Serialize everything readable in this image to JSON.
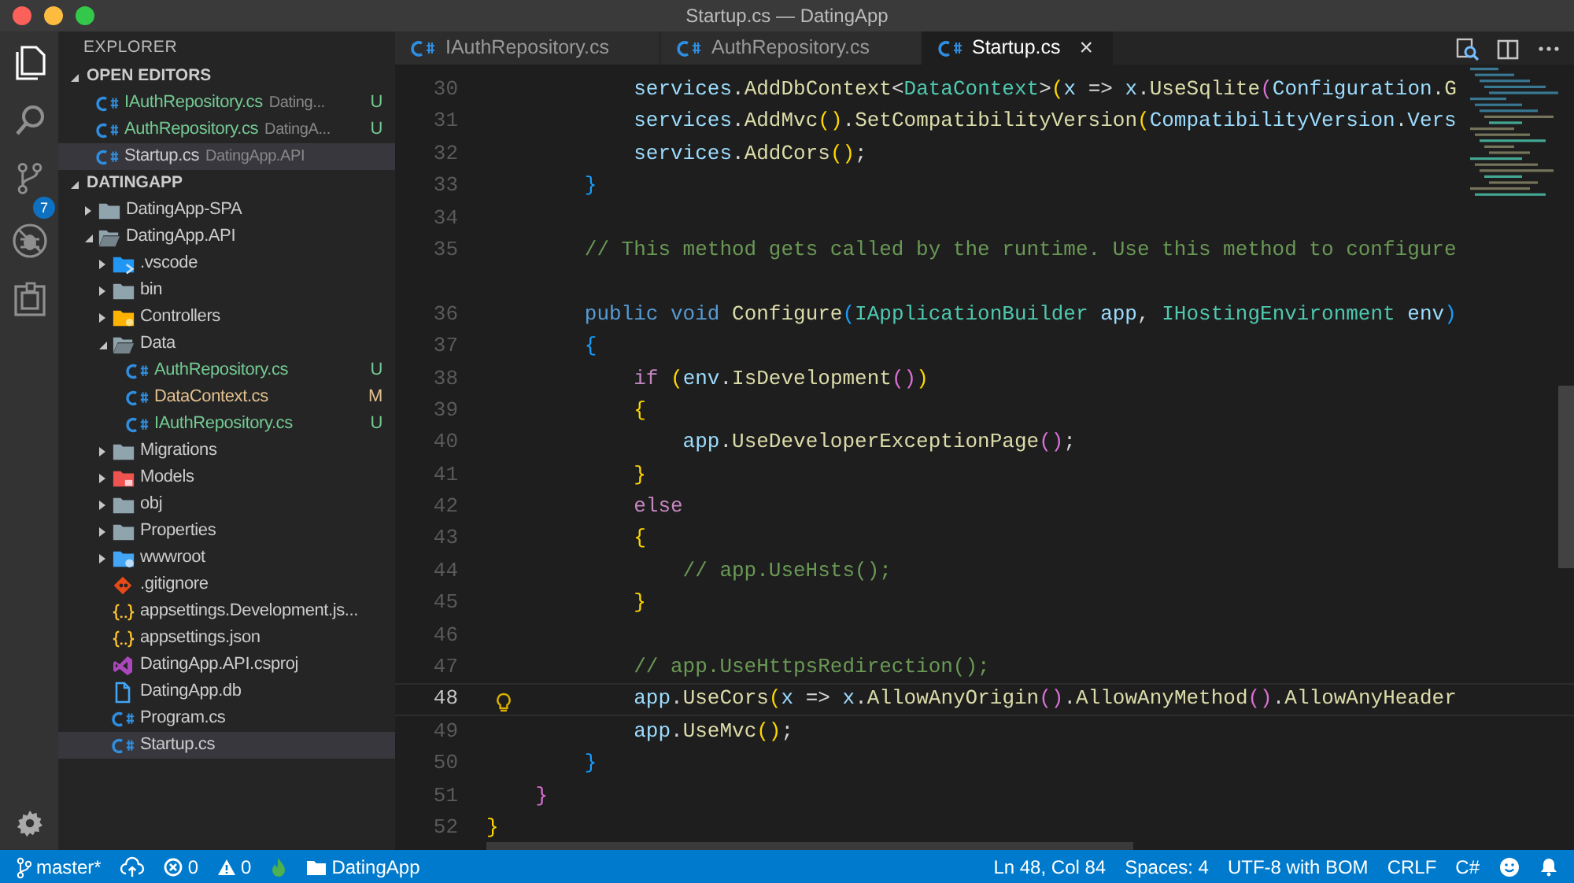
{
  "window": {
    "title": "Startup.cs — DatingApp"
  },
  "activity_bar": {
    "items": [
      {
        "kind": "files",
        "selected": true
      },
      {
        "kind": "search",
        "selected": false
      },
      {
        "kind": "source-control",
        "selected": false,
        "badge": "7"
      },
      {
        "kind": "debug",
        "selected": false
      },
      {
        "kind": "extensions",
        "selected": false
      }
    ]
  },
  "sidebar": {
    "title": "EXPLORER",
    "open_editors": {
      "title": "OPEN EDITORS",
      "expanded": true,
      "items": [
        {
          "kind": "csharp",
          "name": "IAuthRepository.cs",
          "description": "Dating...",
          "git": "U",
          "selected": false
        },
        {
          "kind": "csharp",
          "name": "AuthRepository.cs",
          "description": "DatingA...",
          "git": "U",
          "selected": false
        },
        {
          "kind": "csharp",
          "name": "Startup.cs",
          "description": "DatingApp.API",
          "selected": true
        }
      ]
    },
    "workspace": {
      "title": "DATINGAPP",
      "expanded": true,
      "tree": [
        {
          "kind": "folder",
          "name": "DatingApp-SPA",
          "expanded": false,
          "selected": false
        },
        {
          "kind": "folder",
          "name": "DatingApp.API",
          "expanded": true,
          "selected": false,
          "children": [
            {
              "kind": "folder-vscode",
              "name": ".vscode",
              "expanded": false,
              "selected": false
            },
            {
              "kind": "folder",
              "name": "bin",
              "expanded": false,
              "selected": false
            },
            {
              "kind": "folder-controllers",
              "name": "Controllers",
              "expanded": false,
              "selected": false
            },
            {
              "kind": "folder",
              "name": "Data",
              "expanded": true,
              "selected": false,
              "children": [
                {
                  "kind": "csharp",
                  "name": "AuthRepository.cs",
                  "git": "U",
                  "selected": false
                },
                {
                  "kind": "csharp",
                  "name": "DataContext.cs",
                  "git": "M",
                  "selected": false
                },
                {
                  "kind": "csharp",
                  "name": "IAuthRepository.cs",
                  "git": "U",
                  "selected": false
                }
              ]
            },
            {
              "kind": "folder",
              "name": "Migrations",
              "expanded": false,
              "selected": false
            },
            {
              "kind": "folder-models",
              "name": "Models",
              "expanded": false,
              "selected": false
            },
            {
              "kind": "folder",
              "name": "obj",
              "expanded": false,
              "selected": false
            },
            {
              "kind": "folder",
              "name": "Properties",
              "expanded": false,
              "selected": false
            },
            {
              "kind": "folder-www",
              "name": "wwwroot",
              "expanded": false,
              "selected": false
            },
            {
              "kind": "git",
              "name": ".gitignore",
              "selected": false
            },
            {
              "kind": "json",
              "name": "appsettings.Development.js...",
              "selected": false
            },
            {
              "kind": "json",
              "name": "appsettings.json",
              "selected": false
            },
            {
              "kind": "csproj",
              "name": "DatingApp.API.csproj",
              "selected": false
            },
            {
              "kind": "file",
              "name": "DatingApp.db",
              "selected": false
            },
            {
              "kind": "csharp",
              "name": "Program.cs",
              "selected": false
            },
            {
              "kind": "csharp",
              "name": "Startup.cs",
              "selected": true
            }
          ]
        }
      ]
    }
  },
  "tabs": [
    {
      "name": "IAuthRepository.cs",
      "selected": false
    },
    {
      "name": "AuthRepository.cs",
      "selected": false
    },
    {
      "name": "Startup.cs",
      "selected": true,
      "close": "×"
    }
  ],
  "editor_actions": [
    {
      "kind": "open-changes"
    },
    {
      "kind": "split"
    },
    {
      "kind": "more"
    }
  ],
  "editor": {
    "lines": [
      {
        "number": "30",
        "current": false,
        "tokens": [
          {
            "kind": "var",
            "text": "            services"
          },
          {
            "kind": "plain",
            "text": "."
          },
          {
            "kind": "func",
            "text": "AddDbContext"
          },
          {
            "kind": "plain",
            "text": "<"
          },
          {
            "kind": "type",
            "text": "DataContext"
          },
          {
            "kind": "plain",
            "text": ">"
          },
          {
            "kind": "b1",
            "text": "("
          },
          {
            "kind": "var",
            "text": "x"
          },
          {
            "kind": "plain",
            "text": " => "
          },
          {
            "kind": "var",
            "text": "x"
          },
          {
            "kind": "plain",
            "text": "."
          },
          {
            "kind": "func",
            "text": "UseSqlite"
          },
          {
            "kind": "b2",
            "text": "("
          },
          {
            "kind": "var",
            "text": "Configuration"
          },
          {
            "kind": "plain",
            "text": "."
          },
          {
            "kind": "func",
            "text": "G"
          }
        ]
      },
      {
        "number": "31",
        "current": false,
        "tokens": [
          {
            "kind": "var",
            "text": "            services"
          },
          {
            "kind": "plain",
            "text": "."
          },
          {
            "kind": "func",
            "text": "AddMvc"
          },
          {
            "kind": "b1",
            "text": "()"
          },
          {
            "kind": "plain",
            "text": "."
          },
          {
            "kind": "func",
            "text": "SetCompatibilityVersion"
          },
          {
            "kind": "b1",
            "text": "("
          },
          {
            "kind": "var",
            "text": "CompatibilityVersion"
          },
          {
            "kind": "plain",
            "text": "."
          },
          {
            "kind": "var",
            "text": "Vers"
          }
        ]
      },
      {
        "number": "32",
        "current": false,
        "tokens": [
          {
            "kind": "var",
            "text": "            services"
          },
          {
            "kind": "plain",
            "text": "."
          },
          {
            "kind": "func",
            "text": "AddCors"
          },
          {
            "kind": "b1",
            "text": "()"
          },
          {
            "kind": "plain",
            "text": ";"
          }
        ]
      },
      {
        "number": "33",
        "current": false,
        "tokens": [
          {
            "kind": "b3",
            "text": "        }"
          }
        ]
      },
      {
        "number": "34",
        "current": false
      },
      {
        "number": "35",
        "current": false,
        "tokens": [
          {
            "kind": "comment",
            "text": "        // This method gets called by the runtime. Use this method to configure"
          }
        ]
      },
      {
        "number": "36",
        "current": false,
        "spaced": true,
        "tokens": [
          {
            "kind": "keyword",
            "text": "        public void "
          },
          {
            "kind": "func",
            "text": "Configure"
          },
          {
            "kind": "b3",
            "text": "("
          },
          {
            "kind": "type",
            "text": "IApplicationBuilder"
          },
          {
            "kind": "var",
            "text": " app"
          },
          {
            "kind": "plain",
            "text": ", "
          },
          {
            "kind": "type",
            "text": "IHostingEnvironment"
          },
          {
            "kind": "var",
            "text": " env"
          },
          {
            "kind": "b3",
            "text": ")"
          }
        ]
      },
      {
        "number": "37",
        "current": false,
        "tokens": [
          {
            "kind": "b3",
            "text": "        {"
          }
        ]
      },
      {
        "number": "38",
        "current": false,
        "tokens": [
          {
            "kind": "control",
            "text": "            if "
          },
          {
            "kind": "b1",
            "text": "("
          },
          {
            "kind": "var",
            "text": "env"
          },
          {
            "kind": "plain",
            "text": "."
          },
          {
            "kind": "func",
            "text": "IsDevelopment"
          },
          {
            "kind": "b2",
            "text": "()"
          },
          {
            "kind": "b1",
            "text": ")"
          }
        ]
      },
      {
        "number": "39",
        "current": false,
        "tokens": [
          {
            "kind": "b1",
            "text": "            {"
          }
        ]
      },
      {
        "number": "40",
        "current": false,
        "tokens": [
          {
            "kind": "var",
            "text": "                app"
          },
          {
            "kind": "plain",
            "text": "."
          },
          {
            "kind": "func",
            "text": "UseDeveloperExceptionPage"
          },
          {
            "kind": "b2",
            "text": "()"
          },
          {
            "kind": "plain",
            "text": ";"
          }
        ]
      },
      {
        "number": "41",
        "current": false,
        "tokens": [
          {
            "kind": "b1",
            "text": "            }"
          }
        ]
      },
      {
        "number": "42",
        "current": false,
        "tokens": [
          {
            "kind": "control",
            "text": "            else"
          }
        ]
      },
      {
        "number": "43",
        "current": false,
        "tokens": [
          {
            "kind": "b1",
            "text": "            {"
          }
        ]
      },
      {
        "number": "44",
        "current": false,
        "tokens": [
          {
            "kind": "comment",
            "text": "                // app.UseHsts();"
          }
        ]
      },
      {
        "number": "45",
        "current": false,
        "tokens": [
          {
            "kind": "b1",
            "text": "            }"
          }
        ]
      },
      {
        "number": "46",
        "current": false
      },
      {
        "number": "47",
        "current": false,
        "tokens": [
          {
            "kind": "comment",
            "text": "            // app.UseHttpsRedirection();"
          }
        ]
      },
      {
        "number": "48",
        "current": true,
        "lightbulb": true,
        "tokens": [
          {
            "kind": "var",
            "text": "            app"
          },
          {
            "kind": "plain",
            "text": "."
          },
          {
            "kind": "func",
            "text": "UseCors"
          },
          {
            "kind": "b1",
            "text": "("
          },
          {
            "kind": "var",
            "text": "x"
          },
          {
            "kind": "plain",
            "text": " => "
          },
          {
            "kind": "var",
            "text": "x"
          },
          {
            "kind": "plain",
            "text": "."
          },
          {
            "kind": "func",
            "text": "AllowAnyOrigin"
          },
          {
            "kind": "b2",
            "text": "()"
          },
          {
            "kind": "plain",
            "text": "."
          },
          {
            "kind": "func",
            "text": "AllowAnyMethod"
          },
          {
            "kind": "b2",
            "text": "()"
          },
          {
            "kind": "plain",
            "text": "."
          },
          {
            "kind": "func",
            "text": "AllowAnyHeader"
          }
        ]
      },
      {
        "number": "49",
        "current": false,
        "tokens": [
          {
            "kind": "var",
            "text": "            app"
          },
          {
            "kind": "plain",
            "text": "."
          },
          {
            "kind": "func",
            "text": "UseMvc"
          },
          {
            "kind": "b1",
            "text": "()"
          },
          {
            "kind": "plain",
            "text": ";"
          }
        ]
      },
      {
        "number": "50",
        "current": false,
        "tokens": [
          {
            "kind": "b3",
            "text": "        }"
          }
        ]
      },
      {
        "number": "51",
        "current": false,
        "tokens": [
          {
            "kind": "b2",
            "text": "    }"
          }
        ]
      },
      {
        "number": "52",
        "current": false,
        "tokens": [
          {
            "kind": "b1",
            "text": "}"
          }
        ]
      }
    ]
  },
  "status_bar": {
    "branch": "master*",
    "errors": "0",
    "warnings": "0",
    "folder": "DatingApp",
    "position": "Ln 48, Col 84",
    "indentation": "Spaces: 4",
    "encoding": "UTF-8 with BOM",
    "line_ending": "CRLF",
    "language": "C#"
  }
}
